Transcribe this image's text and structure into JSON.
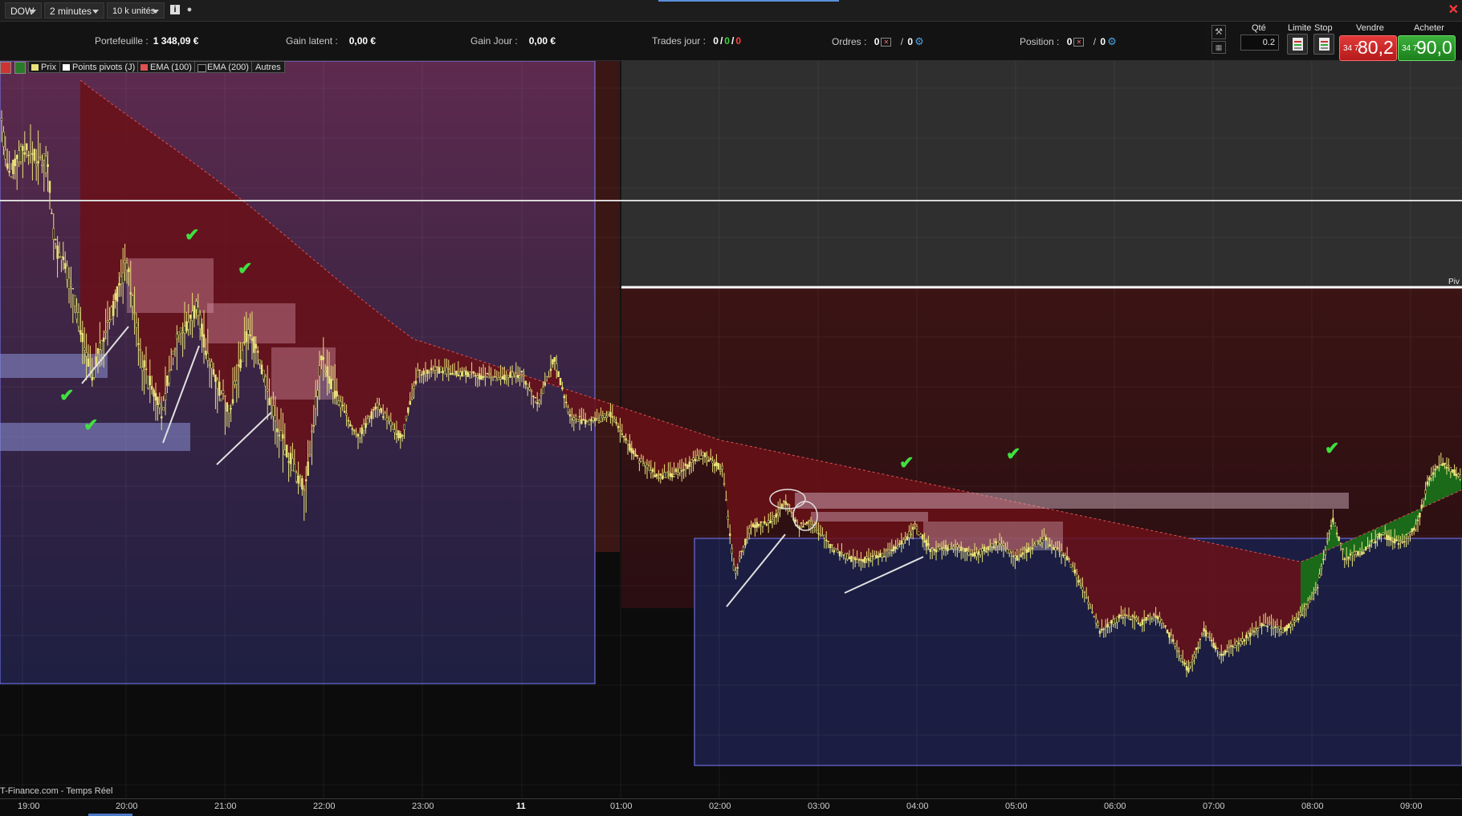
{
  "toolbar": {
    "instrument": "DOW",
    "timeframe": "2 minutes",
    "units": "10 k unités",
    "info_icon": "info-icon",
    "dot_icon": "record-icon"
  },
  "infobar": {
    "portfolio_label": "Portefeuille :",
    "portfolio_value": "1 348,09 €",
    "latent_label": "Gain latent :",
    "latent_value": "0,00 €",
    "day_label": "Gain Jour :",
    "day_value": "0,00 €",
    "trades_label": "Trades jour :",
    "trades_total": "0",
    "trades_win": "0",
    "trades_loss": "0",
    "orders_label": "Ordres :",
    "orders_a": "0",
    "orders_b": "0",
    "position_label": "Position :",
    "position_a": "0",
    "position_b": "0",
    "sep1": "/",
    "sep2": "/"
  },
  "ticket": {
    "qty_label": "Qté",
    "qty_value": "0.2",
    "limit_label": "Limite",
    "stop_label": "Stop",
    "sell_label": "Vendre",
    "buy_label": "Acheter",
    "sell_small": "34 7",
    "sell_big": "80,2",
    "buy_small": "34 7",
    "buy_big": "90,0"
  },
  "legend": {
    "price": "Prix",
    "pivots": "Points pivots (J)",
    "ema100": "EMA (100)",
    "ema200": "EMA (200)",
    "others": "Autres"
  },
  "chart": {
    "pivot_label": "Piv",
    "watermark": "T-Finance.com - Temps Réel",
    "time_ticks": [
      "19:00",
      "20:00",
      "21:00",
      "22:00",
      "23:00",
      "11",
      "01:00",
      "02:00",
      "03:00",
      "04:00",
      "05:00",
      "06:00",
      "07:00",
      "08:00",
      "09:00"
    ],
    "colors": {
      "candle": "#e8e27a",
      "ema_fill_bear": "#6a1018",
      "ema_fill_bull": "#1a6a1a",
      "zone_blue": "#1a1f44",
      "zone_purple": "#5a2a4a",
      "zone_dark": "#3a1a1a",
      "pivot_line": "#ffffff",
      "check": "#3fe03f"
    }
  }
}
